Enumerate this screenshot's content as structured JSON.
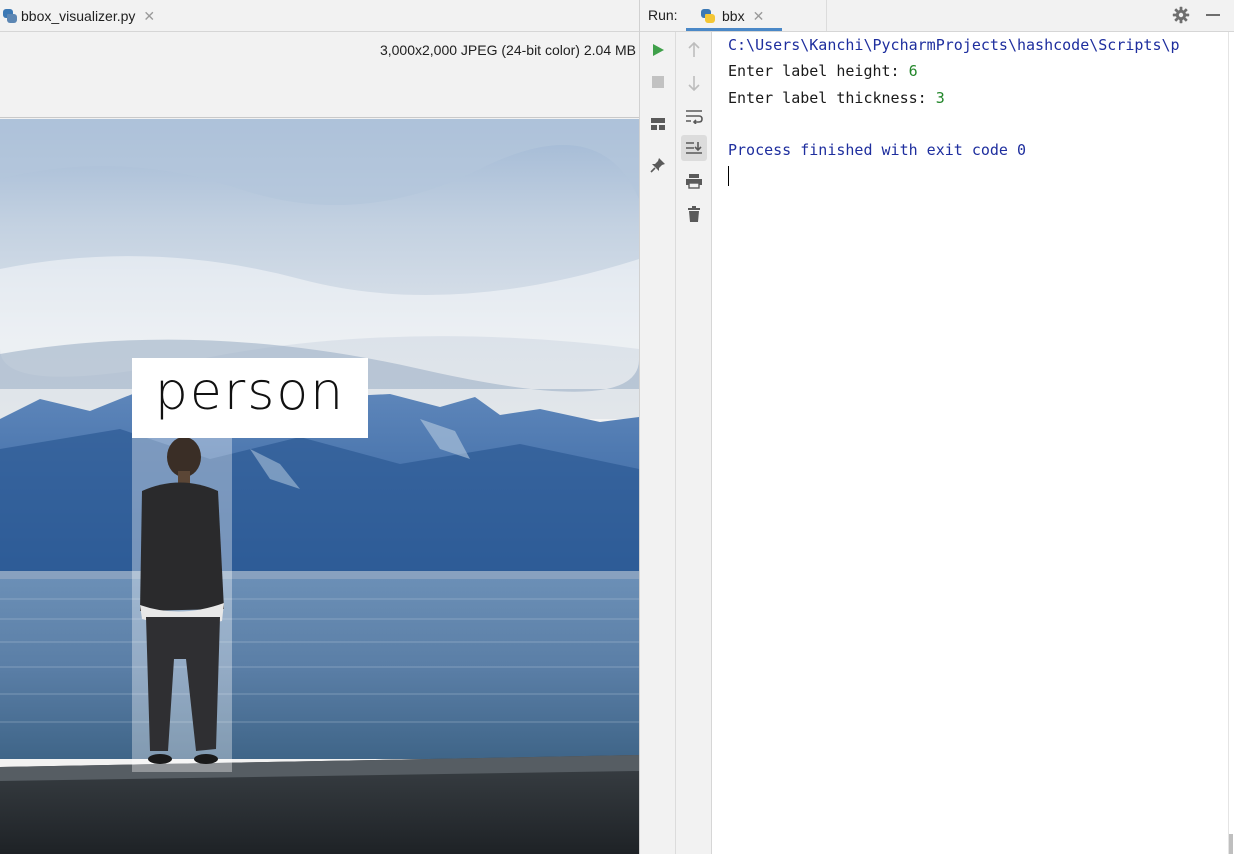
{
  "editor": {
    "tab": {
      "label": "bbox_visualizer.py",
      "icon": "python-file-icon",
      "close": "✕"
    },
    "image_info": "3,000x2,000 JPEG (24-bit color) 2.04 MB",
    "image": {
      "description_icon": "image-preview",
      "bbox_label": "person",
      "colors": {
        "sky": "#c9d6e6",
        "mountains": "#3f6fae",
        "lake": "#4f76a0",
        "wall": "#2e3338",
        "label_bg": "#ffffff"
      }
    }
  },
  "run": {
    "title": "Run:",
    "tab": {
      "label": "bbx",
      "icon": "python-icon",
      "close": "✕"
    },
    "toolbar_left": [
      "run-icon",
      "stop-icon",
      "layout-icon",
      "pin-icon"
    ],
    "toolbar_right": [
      "up-arrow-icon",
      "down-arrow-icon",
      "soft-wrap-icon",
      "scroll-to-end-icon",
      "print-icon",
      "trash-icon"
    ],
    "console": {
      "path": "C:\\Users\\Kanchi\\PycharmProjects\\hashcode\\Scripts\\p",
      "prompt1": "Enter label height: ",
      "input1": "6",
      "prompt2": "Enter label thickness: ",
      "input2": "3",
      "finished": "Process finished with exit code 0"
    },
    "colors": {
      "path": "#1e2e9e",
      "input": "#22862a",
      "accent": "#4a88c7"
    }
  }
}
